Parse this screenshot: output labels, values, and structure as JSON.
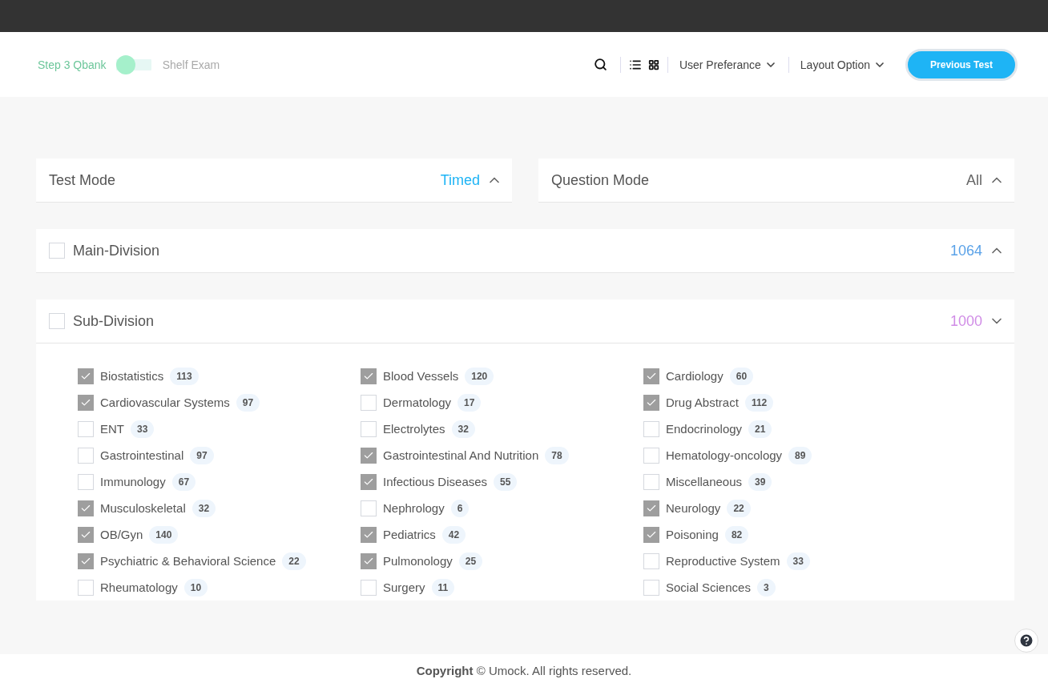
{
  "header": {
    "toggle": {
      "left_label": "Step 3 Qbank",
      "right_label": "Shelf Exam",
      "on": false
    },
    "menus": [
      {
        "label": "User Preferance"
      },
      {
        "label": "Layout Option"
      }
    ],
    "button": "Previous Test"
  },
  "modes": [
    {
      "title": "Test Mode",
      "value": "Timed",
      "color": "#1eb4f5",
      "expanded": true
    },
    {
      "title": "Question Mode",
      "value": "All",
      "color": "#666666",
      "expanded": true
    }
  ],
  "divisions": [
    {
      "title": "Main-Division",
      "count": "1064",
      "color": "#5aa2e8",
      "checked": false,
      "expanded": true
    },
    {
      "title": "Sub-Division",
      "count": "1000",
      "color": "#d08ce6",
      "checked": false,
      "expanded": false
    }
  ],
  "subjects": [
    [
      {
        "name": "Biostatistics",
        "count": "113",
        "checked": true
      },
      {
        "name": "Cardiovascular Systems",
        "count": "97",
        "checked": true
      },
      {
        "name": "ENT",
        "count": "33",
        "checked": false
      },
      {
        "name": "Gastrointestinal",
        "count": "97",
        "checked": false
      },
      {
        "name": "Immunology",
        "count": "67",
        "checked": false
      },
      {
        "name": "Musculoskeletal",
        "count": "32",
        "checked": true
      },
      {
        "name": "OB/Gyn",
        "count": "140",
        "checked": true
      },
      {
        "name": "Psychiatric & Behavioral Science",
        "count": "22",
        "checked": true
      },
      {
        "name": "Rheumatology",
        "count": "10",
        "checked": false
      }
    ],
    [
      {
        "name": "Blood Vessels",
        "count": "120",
        "checked": true
      },
      {
        "name": "Dermatology",
        "count": "17",
        "checked": false
      },
      {
        "name": "Electrolytes",
        "count": "32",
        "checked": false
      },
      {
        "name": "Gastrointestinal And Nutrition",
        "count": "78",
        "checked": true
      },
      {
        "name": "Infectious Diseases",
        "count": "55",
        "checked": true
      },
      {
        "name": "Nephrology",
        "count": "6",
        "checked": false
      },
      {
        "name": "Pediatrics",
        "count": "42",
        "checked": true
      },
      {
        "name": "Pulmonology",
        "count": "25",
        "checked": true
      },
      {
        "name": "Surgery",
        "count": "11",
        "checked": false
      }
    ],
    [
      {
        "name": "Cardiology",
        "count": "60",
        "checked": true
      },
      {
        "name": "Drug Abstract",
        "count": "112",
        "checked": true
      },
      {
        "name": "Endocrinology",
        "count": "21",
        "checked": false
      },
      {
        "name": "Hematology-oncology",
        "count": "89",
        "checked": false
      },
      {
        "name": "Miscellaneous",
        "count": "39",
        "checked": false
      },
      {
        "name": "Neurology",
        "count": "22",
        "checked": true
      },
      {
        "name": "Poisoning",
        "count": "82",
        "checked": true
      },
      {
        "name": "Reproductive System",
        "count": "33",
        "checked": false
      },
      {
        "name": "Social Sciences",
        "count": "3",
        "checked": false
      }
    ]
  ],
  "footer": "**Copyright** © Umock. All rights reserved."
}
